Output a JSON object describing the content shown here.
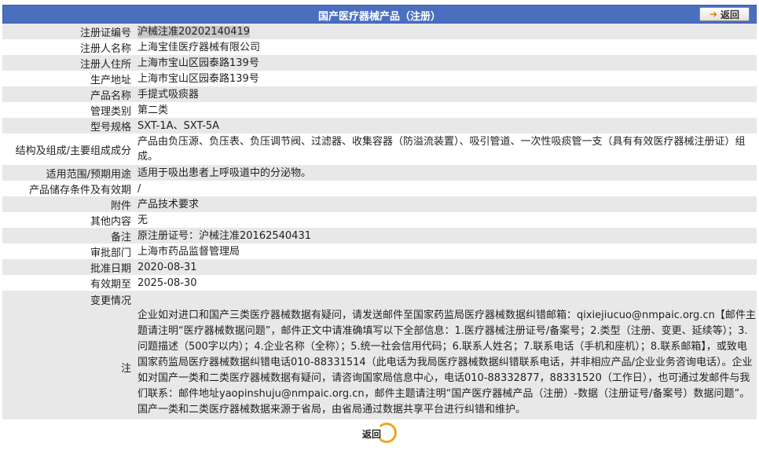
{
  "header": {
    "title": "国产医疗器械产品（注册）",
    "back_label": "返回"
  },
  "rows": [
    {
      "label": "注册证编号",
      "value": "沪械注准20202140419"
    },
    {
      "label": "注册人名称",
      "value": "上海宝佳医疗器械有限公司"
    },
    {
      "label": "注册人住所",
      "value": "上海市宝山区园泰路139号"
    },
    {
      "label": "生产地址",
      "value": "上海市宝山区园泰路139号"
    },
    {
      "label": "产品名称",
      "value": "手提式吸痰器"
    },
    {
      "label": "管理类别",
      "value": "第二类"
    },
    {
      "label": "型号规格",
      "value": "SXT-1A、SXT-5A"
    },
    {
      "label": "结构及组成/主要组成成分",
      "value": "产品由负压源、负压表、负压调节阀、过滤器、收集容器（防溢流装置）、吸引管道、一次性吸痰管一支（具有有效医疗器械注册证）组成。"
    },
    {
      "label": "适用范围/预期用途",
      "value": "适用于吸出患者上呼吸道中的分泌物。"
    },
    {
      "label": "产品储存条件及有效期",
      "value": "/"
    },
    {
      "label": "附件",
      "value": "产品技术要求"
    },
    {
      "label": "其他内容",
      "value": "无"
    },
    {
      "label": "备注",
      "value": "原注册证号：沪械注准20162540431"
    },
    {
      "label": "审批部门",
      "value": "上海市药品监督管理局"
    },
    {
      "label": "批准日期",
      "value": "2020-08-31"
    },
    {
      "label": "有效期至",
      "value": "2025-08-30"
    },
    {
      "label": "变更情况",
      "value": ""
    }
  ],
  "note": {
    "label": "注",
    "text": "企业如对进口和国产三类医疗器械数据有疑问，请发送邮件至国家药监局医疗器械数据纠错邮箱：qixiejiucuo@nmpaic.org.cn【邮件主题请注明“医疗器械数据问题”，邮件正文中请准确填写以下全部信息：1.医疗器械注册证号/备案号；2.类型（注册、变更、延续等）；3.问题描述（500字以内）；4.企业名称（全称）；5.统一社会信用代码；6.联系人姓名；7.联系电话（手机和座机）；8.联系邮箱】，或致电国家药监局医疗器械数据纠错电话010-88331514（此电话为我局医疗器械数据纠错联系电话，并非相应产品/企业业务咨询电话）。企业如对国产一类和二类医疗器械数据有疑问，请咨询国家局信息中心，电话010-88332877，88331520（工作日），也可通过发邮件与我们联系：邮件地址yaopinshuju@nmpaic.org.cn，邮件主题请注明“国产医疗器械产品（注册）-数据（注册证号/备案号）数据问题”。国产一类和二类医疗器械数据来源于省局，由省局通过数据共享平台进行纠错和维护。"
  },
  "footer": {
    "back_label": "返回"
  },
  "colors": {
    "header_bg": "#4a6fbf",
    "row_alt_bg": "#e8e8e8",
    "accent_orange": "#f2a51a"
  }
}
